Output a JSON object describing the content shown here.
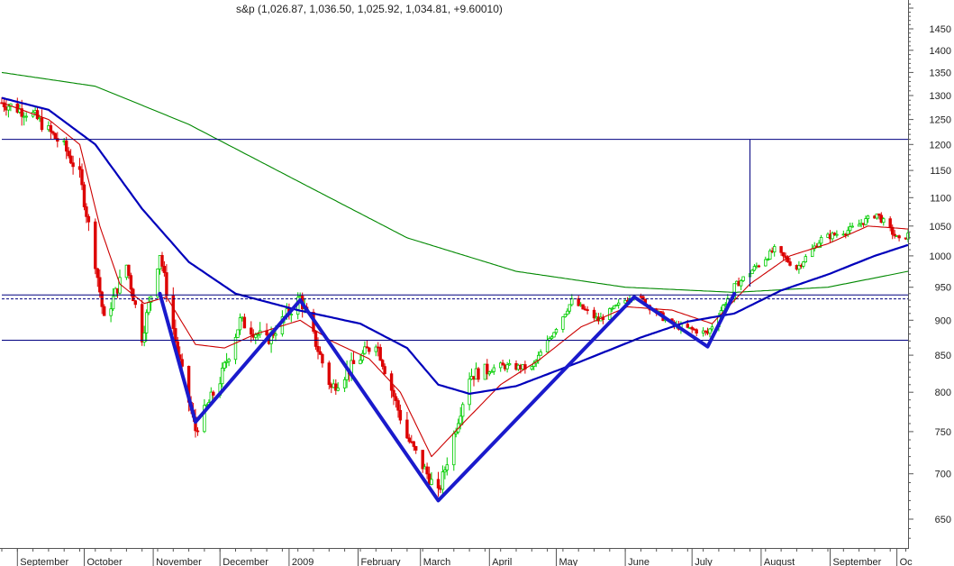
{
  "chart_data": {
    "type": "candlestick",
    "title": "s&p (1,026.87, 1,036.50, 1,025.92, 1,034.81, +9.60010)",
    "y_scale": "log",
    "ylim": [
      620,
      1520
    ],
    "yticks": [
      650,
      700,
      750,
      800,
      850,
      900,
      950,
      1000,
      1050,
      1100,
      1150,
      1200,
      1250,
      1300,
      1350,
      1400,
      1450
    ],
    "months": [
      {
        "label": "September",
        "date": "2008-09-01"
      },
      {
        "label": "October",
        "date": "2008-10-01"
      },
      {
        "label": "November",
        "date": "2008-11-01"
      },
      {
        "label": "December",
        "date": "2008-12-01"
      },
      {
        "label": "2009",
        "date": "2009-01-01"
      },
      {
        "label": "February",
        "date": "2009-02-01"
      },
      {
        "label": "March",
        "date": "2009-03-01"
      },
      {
        "label": "April",
        "date": "2009-04-01"
      },
      {
        "label": "May",
        "date": "2009-05-01"
      },
      {
        "label": "June",
        "date": "2009-06-01"
      },
      {
        "label": "July",
        "date": "2009-07-01"
      },
      {
        "label": "August",
        "date": "2009-08-01"
      },
      {
        "label": "September",
        "date": "2009-09-01"
      },
      {
        "label": "Oc",
        "date": "2009-10-01"
      }
    ],
    "x_range": [
      "2008-08-25",
      "2009-10-06"
    ],
    "path_points": [
      {
        "date": "2008-08-25",
        "close": 1285
      },
      {
        "date": "2008-09-08",
        "close": 1260
      },
      {
        "date": "2008-09-22",
        "close": 1195
      },
      {
        "date": "2008-09-29",
        "close": 1140
      },
      {
        "date": "2008-10-06",
        "close": 990
      },
      {
        "date": "2008-10-10",
        "close": 899
      },
      {
        "date": "2008-10-20",
        "close": 985
      },
      {
        "date": "2008-10-27",
        "close": 876
      },
      {
        "date": "2008-11-04",
        "close": 1005
      },
      {
        "date": "2008-11-12",
        "close": 852
      },
      {
        "date": "2008-11-20",
        "close": 752
      },
      {
        "date": "2008-12-01",
        "close": 816
      },
      {
        "date": "2008-12-10",
        "close": 899
      },
      {
        "date": "2008-12-22",
        "close": 870
      },
      {
        "date": "2009-01-06",
        "close": 934
      },
      {
        "date": "2009-01-20",
        "close": 805
      },
      {
        "date": "2009-02-09",
        "close": 870
      },
      {
        "date": "2009-02-23",
        "close": 743
      },
      {
        "date": "2009-03-09",
        "close": 677
      },
      {
        "date": "2009-03-23",
        "close": 822
      },
      {
        "date": "2009-04-06",
        "close": 835
      },
      {
        "date": "2009-04-20",
        "close": 832
      },
      {
        "date": "2009-05-08",
        "close": 929
      },
      {
        "date": "2009-05-20",
        "close": 900
      },
      {
        "date": "2009-06-05",
        "close": 940
      },
      {
        "date": "2009-06-22",
        "close": 893
      },
      {
        "date": "2009-07-08",
        "close": 881
      },
      {
        "date": "2009-07-20",
        "close": 951
      },
      {
        "date": "2009-08-07",
        "close": 1010
      },
      {
        "date": "2009-08-17",
        "close": 980
      },
      {
        "date": "2009-08-28",
        "close": 1028
      },
      {
        "date": "2009-09-10",
        "close": 1044
      },
      {
        "date": "2009-09-22",
        "close": 1071
      },
      {
        "date": "2009-10-02",
        "close": 1025
      },
      {
        "date": "2009-10-06",
        "close": 1035
      }
    ],
    "ma_short": [
      {
        "date": "2008-08-25",
        "value": 1285
      },
      {
        "date": "2008-09-15",
        "value": 1250
      },
      {
        "date": "2008-09-29",
        "value": 1200
      },
      {
        "date": "2008-10-08",
        "value": 1050
      },
      {
        "date": "2008-10-17",
        "value": 955
      },
      {
        "date": "2008-10-28",
        "value": 925
      },
      {
        "date": "2008-11-07",
        "value": 935
      },
      {
        "date": "2008-11-20",
        "value": 865
      },
      {
        "date": "2008-12-03",
        "value": 860
      },
      {
        "date": "2008-12-17",
        "value": 880
      },
      {
        "date": "2009-01-06",
        "value": 900
      },
      {
        "date": "2009-01-20",
        "value": 870
      },
      {
        "date": "2009-02-06",
        "value": 845
      },
      {
        "date": "2009-02-20",
        "value": 800
      },
      {
        "date": "2009-03-06",
        "value": 720
      },
      {
        "date": "2009-03-20",
        "value": 760
      },
      {
        "date": "2009-04-06",
        "value": 810
      },
      {
        "date": "2009-04-24",
        "value": 845
      },
      {
        "date": "2009-05-12",
        "value": 890
      },
      {
        "date": "2009-06-02",
        "value": 920
      },
      {
        "date": "2009-06-22",
        "value": 915
      },
      {
        "date": "2009-07-10",
        "value": 895
      },
      {
        "date": "2009-07-27",
        "value": 955
      },
      {
        "date": "2009-08-14",
        "value": 1000
      },
      {
        "date": "2009-08-31",
        "value": 1020
      },
      {
        "date": "2009-09-18",
        "value": 1050
      },
      {
        "date": "2009-10-06",
        "value": 1045
      }
    ],
    "ma_medium": [
      {
        "date": "2008-08-25",
        "value": 1295
      },
      {
        "date": "2008-09-15",
        "value": 1270
      },
      {
        "date": "2008-10-06",
        "value": 1200
      },
      {
        "date": "2008-10-27",
        "value": 1080
      },
      {
        "date": "2008-11-17",
        "value": 990
      },
      {
        "date": "2008-12-08",
        "value": 940
      },
      {
        "date": "2009-01-05",
        "value": 915
      },
      {
        "date": "2009-02-02",
        "value": 895
      },
      {
        "date": "2009-02-23",
        "value": 860
      },
      {
        "date": "2009-03-09",
        "value": 810
      },
      {
        "date": "2009-03-23",
        "value": 798
      },
      {
        "date": "2009-04-13",
        "value": 808
      },
      {
        "date": "2009-05-11",
        "value": 840
      },
      {
        "date": "2009-06-08",
        "value": 875
      },
      {
        "date": "2009-06-29",
        "value": 898
      },
      {
        "date": "2009-07-20",
        "value": 910
      },
      {
        "date": "2009-08-10",
        "value": 945
      },
      {
        "date": "2009-08-31",
        "value": 970
      },
      {
        "date": "2009-09-21",
        "value": 1000
      },
      {
        "date": "2009-10-06",
        "value": 1018
      }
    ],
    "ma_long": [
      {
        "date": "2008-08-25",
        "value": 1350
      },
      {
        "date": "2008-10-06",
        "value": 1320
      },
      {
        "date": "2008-11-17",
        "value": 1240
      },
      {
        "date": "2009-01-05",
        "value": 1130
      },
      {
        "date": "2009-02-23",
        "value": 1030
      },
      {
        "date": "2009-04-13",
        "value": 975
      },
      {
        "date": "2009-06-01",
        "value": 950
      },
      {
        "date": "2009-07-20",
        "value": 942
      },
      {
        "date": "2009-08-31",
        "value": 950
      },
      {
        "date": "2009-10-06",
        "value": 975
      }
    ],
    "horizontal_lines": [
      {
        "value": 1210,
        "style": "solid"
      },
      {
        "value": 938,
        "style": "solid"
      },
      {
        "value": 932,
        "style": "dashed"
      },
      {
        "value": 871,
        "style": "solid"
      }
    ],
    "projection_line": {
      "date": "2009-07-27",
      "from": 951,
      "to": 1210
    },
    "pattern_lines": [
      {
        "date": "2008-11-04",
        "value": 940
      },
      {
        "date": "2008-11-20",
        "value": 762
      },
      {
        "date": "2009-01-06",
        "value": 930
      },
      {
        "date": "2009-03-09",
        "value": 670
      },
      {
        "date": "2009-06-05",
        "value": 935
      },
      {
        "date": "2009-07-08",
        "value": 862
      },
      {
        "date": "2009-07-20",
        "value": 940
      }
    ],
    "colors": {
      "up": "#00cc00",
      "down": "#dd0000",
      "ma_short": "#cc0000",
      "ma_medium": "#0000bb",
      "ma_long": "#008800",
      "pattern": "#1a1acc",
      "hline": "#000080",
      "axis": "#555555"
    }
  }
}
